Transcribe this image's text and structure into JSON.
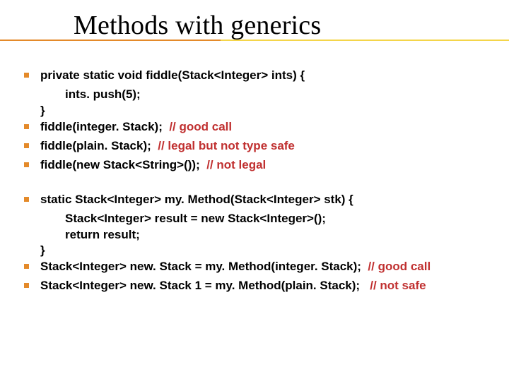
{
  "title": "Methods with generics",
  "group1": {
    "item1": {
      "main": "private static void fiddle(Stack<Integer> ints) {",
      "sub1": "ints. push(5);",
      "sub2": "}"
    },
    "item2": {
      "code": "fiddle(integer. Stack);  ",
      "comment": "// good call"
    },
    "item3": {
      "code": "fiddle(plain. Stack);  ",
      "comment": "// legal but not type safe"
    },
    "item4": {
      "code": "fiddle(new Stack<String>());  ",
      "comment": "// not legal"
    }
  },
  "group2": {
    "item1": {
      "main": "static Stack<Integer> my. Method(Stack<Integer> stk) {",
      "sub1": "Stack<Integer> result = new Stack<Integer>();",
      "sub2": "return result;",
      "sub3": "}"
    },
    "item2": {
      "code": "Stack<Integer> new. Stack = my. Method(integer. Stack);  ",
      "comment": "// good call"
    },
    "item3": {
      "code": "Stack<Integer> new. Stack 1 = my. Method(plain. Stack);   ",
      "comment": "// not safe"
    }
  }
}
